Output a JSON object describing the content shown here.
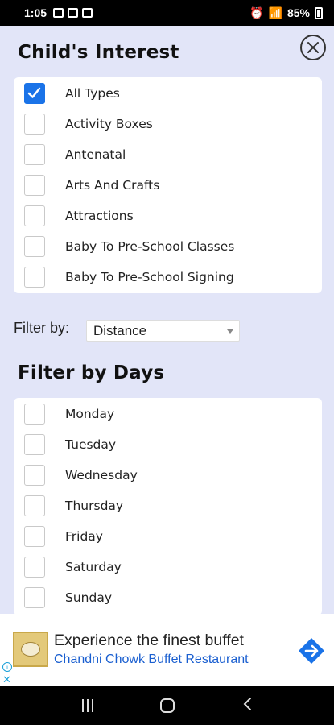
{
  "status_bar": {
    "time": "1:05",
    "battery": "85%"
  },
  "interest": {
    "title": "Child's Interest",
    "items": [
      {
        "label": "All Types",
        "checked": true
      },
      {
        "label": "Activity Boxes",
        "checked": false
      },
      {
        "label": "Antenatal",
        "checked": false
      },
      {
        "label": "Arts And Crafts",
        "checked": false
      },
      {
        "label": "Attractions",
        "checked": false
      },
      {
        "label": "Baby To Pre-School Classes",
        "checked": false
      },
      {
        "label": "Baby To Pre-School Signing",
        "checked": false
      }
    ]
  },
  "filter": {
    "label": "Filter by:",
    "selected": "Distance"
  },
  "days": {
    "title": "Filter by Days",
    "items": [
      {
        "label": "Monday",
        "checked": false
      },
      {
        "label": "Tuesday",
        "checked": false
      },
      {
        "label": "Wednesday",
        "checked": false
      },
      {
        "label": "Thursday",
        "checked": false
      },
      {
        "label": "Friday",
        "checked": false
      },
      {
        "label": "Saturday",
        "checked": false
      },
      {
        "label": "Sunday",
        "checked": false
      }
    ]
  },
  "ad": {
    "headline": "Experience the finest buffet",
    "advertiser": "Chandni Chowk Buffet Restaurant",
    "info_icon": "info-icon",
    "close_glyph": "✕"
  },
  "colors": {
    "accent": "#1a73e8",
    "panel_bg": "#e2e5f8",
    "link": "#1a5fd0"
  }
}
